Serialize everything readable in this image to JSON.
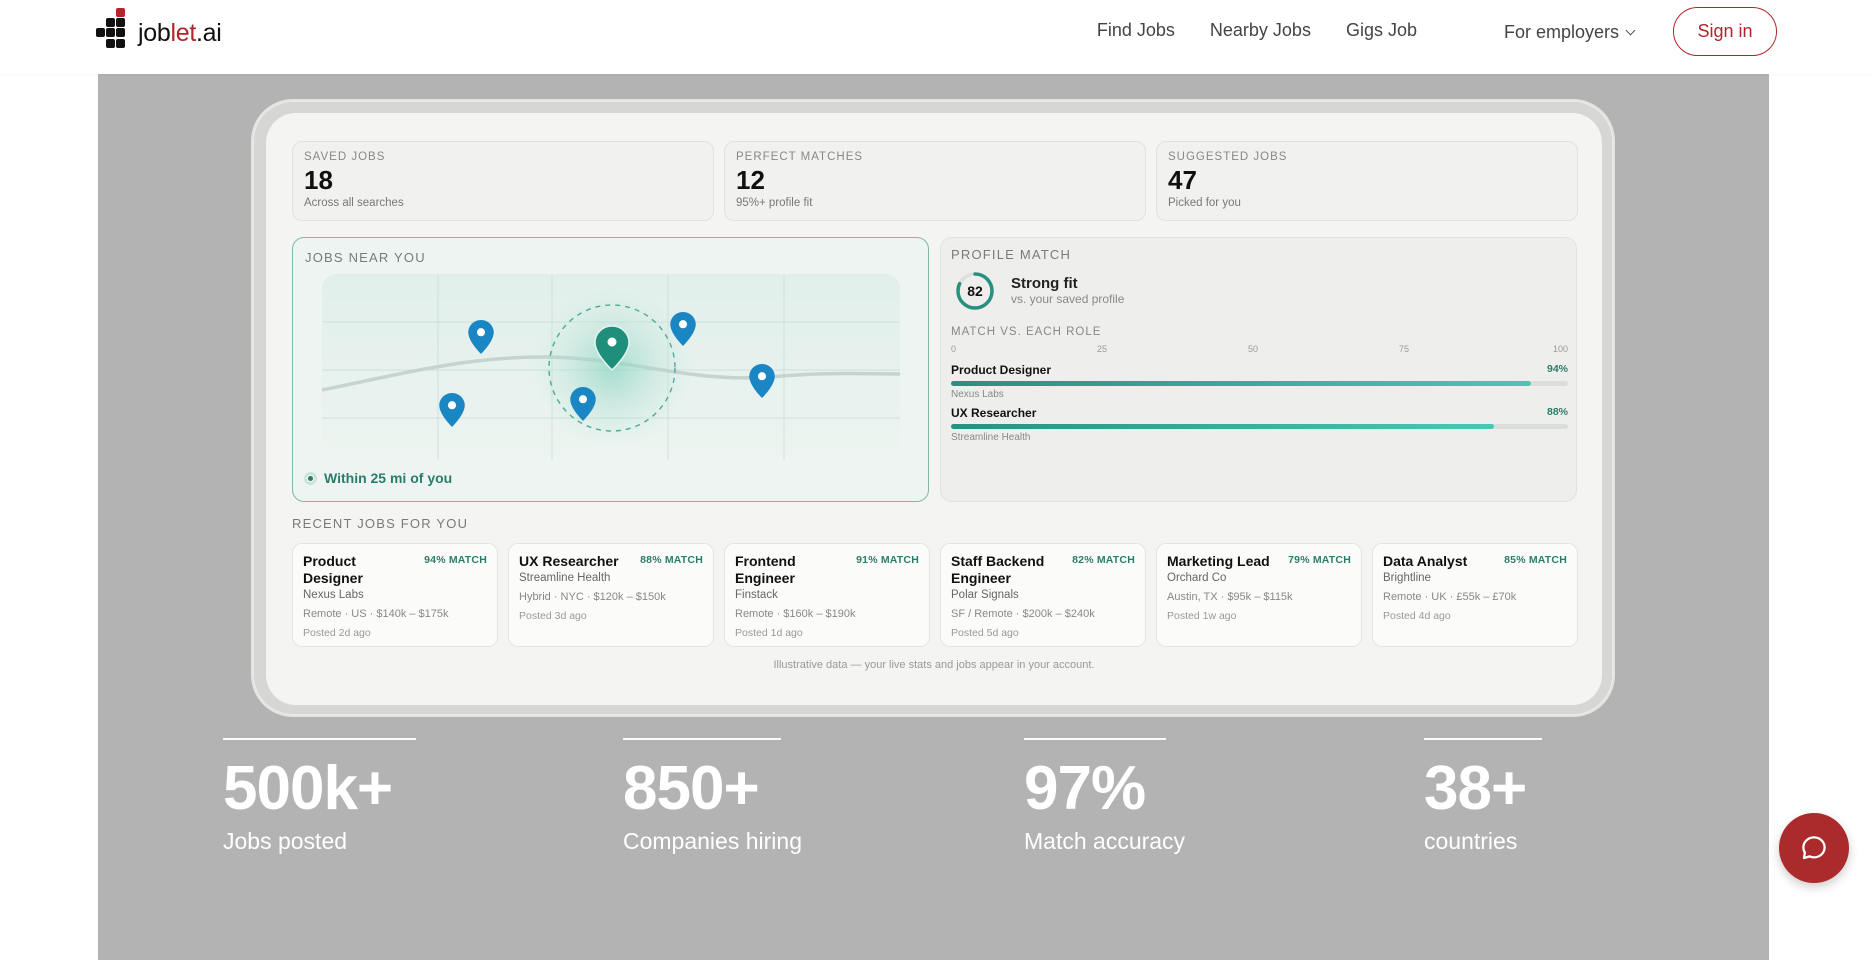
{
  "nav": {
    "logo_job": "job",
    "logo_let": "let",
    "logo_ai": ".ai",
    "links": [
      "Find Jobs",
      "Nearby Jobs",
      "Gigs Job"
    ],
    "employers": "For employers",
    "signin": "Sign in"
  },
  "stats": [
    {
      "label": "SAVED JOBS",
      "value": "18",
      "sub": "Across all searches"
    },
    {
      "label": "PERFECT MATCHES",
      "value": "12",
      "sub": "95%+ profile fit"
    },
    {
      "label": "SUGGESTED JOBS",
      "value": "47",
      "sub": "Picked for you"
    }
  ],
  "map": {
    "title": "JOBS NEAR YOU",
    "legend": "Within 25 mi of you"
  },
  "profile": {
    "title": "PROFILE MATCH",
    "score": "82",
    "score_fraction": 0.82,
    "fit_title": "Strong fit",
    "fit_sub": "vs. your saved profile",
    "roles_title": "MATCH VS. EACH ROLE",
    "ticks": [
      "0",
      "25",
      "50",
      "75",
      "100"
    ],
    "roles": [
      {
        "name": "Product Designer",
        "pct": "94%",
        "value": 94,
        "company": "Nexus Labs"
      },
      {
        "name": "UX Researcher",
        "pct": "88%",
        "value": 88,
        "company": "Streamline Health"
      }
    ]
  },
  "recent": {
    "title": "RECENT JOBS FOR YOU",
    "jobs": [
      {
        "title": "Product Designer",
        "match": "94% MATCH",
        "company": "Nexus Labs",
        "meta": "Remote · US · $140k – $175k",
        "posted": "Posted 2d ago"
      },
      {
        "title": "UX Researcher",
        "match": "88% MATCH",
        "company": "Streamline Health",
        "meta": "Hybrid · NYC · $120k – $150k",
        "posted": "Posted 3d ago"
      },
      {
        "title": "Frontend Engineer",
        "match": "91% MATCH",
        "company": "Finstack",
        "meta": "Remote · $160k – $190k",
        "posted": "Posted 1d ago"
      },
      {
        "title": "Staff Backend Engineer",
        "match": "82% MATCH",
        "company": "Polar Signals",
        "meta": "SF / Remote · $200k – $240k",
        "posted": "Posted 5d ago"
      },
      {
        "title": "Marketing Lead",
        "match": "79% MATCH",
        "company": "Orchard Co",
        "meta": "Austin, TX · $95k – $115k",
        "posted": "Posted 1w ago"
      },
      {
        "title": "Data Analyst",
        "match": "85% MATCH",
        "company": "Brightline",
        "meta": "Remote · UK · £55k – £70k",
        "posted": "Posted 4d ago"
      }
    ],
    "disclaimer": "Illustrative data — your live stats and jobs appear in your account."
  },
  "bottom_stats": [
    {
      "value": "500k+",
      "label": "Jobs posted"
    },
    {
      "value": "850+",
      "label": "Companies hiring"
    },
    {
      "value": "97%",
      "label": "Match accuracy"
    },
    {
      "value": "38+",
      "label": "countries"
    }
  ],
  "colors": {
    "brand": "#b0262c",
    "accent": "#2a7d6b",
    "pin": "#1a86c4",
    "stage": "#b3b3b3"
  }
}
